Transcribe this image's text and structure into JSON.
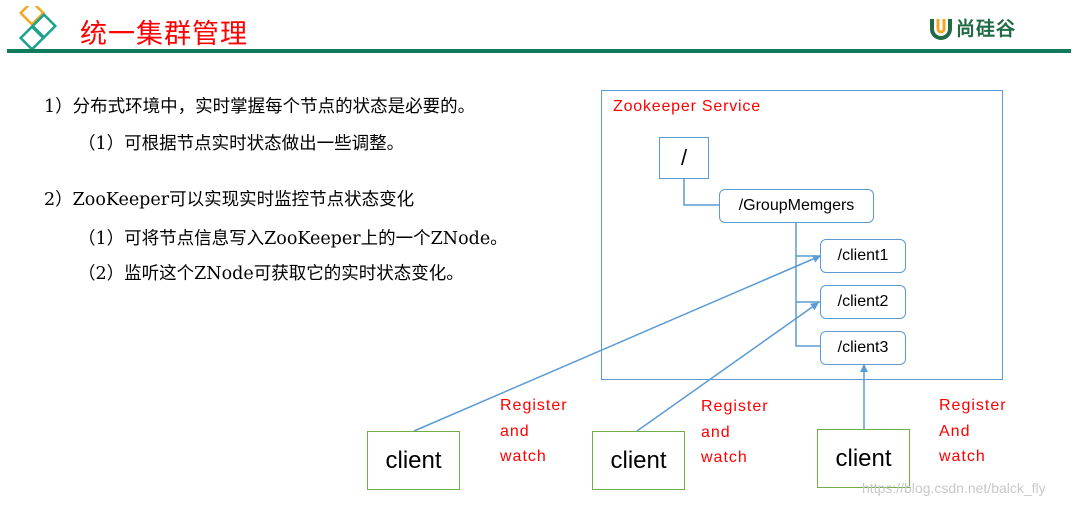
{
  "header": {
    "title": "统一集群管理",
    "brand": "尚硅谷",
    "colors": {
      "title": "#ff0000",
      "rule": "#0f7a5c",
      "brand": "#1f6b45"
    }
  },
  "bullets": [
    {
      "level": 1,
      "text": "1）分布式环境中，实时掌握每个节点的状态是必要的。"
    },
    {
      "level": 2,
      "text": "（1）可根据节点实时状态做出一些调整。"
    },
    {
      "level": 1,
      "text": "2）ZooKeeper可以实现实时监控节点状态变化"
    },
    {
      "level": 2,
      "text": "（1）可将节点信息写入ZooKeeper上的一个ZNode。"
    },
    {
      "level": 2,
      "text": "（2）监听这个ZNode可获取它的实时状态变化。"
    }
  ],
  "diagram": {
    "service_label": "Zookeeper Service",
    "root_node": "/",
    "group_node": "/GroupMemgers",
    "child_nodes": [
      "/client1",
      "/client2",
      "/client3"
    ],
    "clients": [
      {
        "label": "client",
        "annotation": [
          "Register",
          "and",
          "watch"
        ]
      },
      {
        "label": "client",
        "annotation": [
          "Register",
          "and",
          "watch"
        ]
      },
      {
        "label": "client",
        "annotation": [
          "Register",
          "And",
          "watch"
        ]
      }
    ],
    "colors": {
      "node_border": "#5b9bd5",
      "client_border": "#70ad47",
      "annotation": "#ff0000"
    }
  },
  "watermark": "https://blog.csdn.net/balck_fly"
}
